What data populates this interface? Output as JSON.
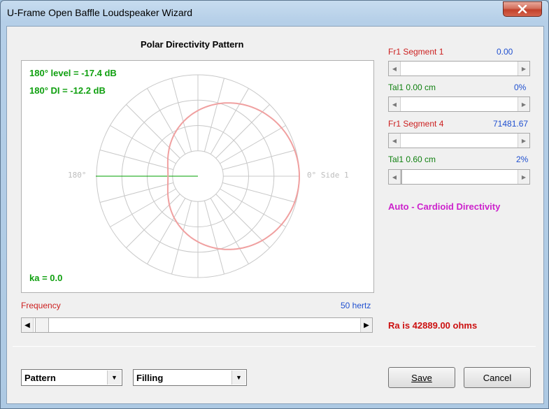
{
  "window": {
    "title": "U-Frame Open Baffle Loudspeaker Wizard"
  },
  "plot": {
    "heading": "Polar Directivity Pattern",
    "level_text": "180° level = -17.4 dB",
    "di_text": "180° DI = -12.2 dB",
    "ka_text": "ka = 0.0",
    "label_180": "180°",
    "label_0": "0° Side 1"
  },
  "chart_data": {
    "type": "polar",
    "title": "Polar Directivity Pattern",
    "pattern": "cardioid",
    "level_180_db": -17.4,
    "di_180_db": -12.2,
    "ka": 0.0
  },
  "frequency": {
    "label": "Frequency",
    "value_text": "50 hertz"
  },
  "params": [
    {
      "label": "Fr1  Segment 1",
      "value": "0.00"
    },
    {
      "label": "Tal1  0.00 cm",
      "value": "0%"
    },
    {
      "label": "Fr1  Segment 4",
      "value": "71481.67"
    },
    {
      "label": "Tal1  0.60 cm",
      "value": "2%"
    }
  ],
  "mode_text": "Auto - Cardioid Directivity",
  "ra_text": "Ra is 42889.00 ohms",
  "selects": {
    "pattern": "Pattern",
    "filling": "Filling"
  },
  "buttons": {
    "save": "Save",
    "cancel": "Cancel"
  },
  "colors": {
    "red": "#cc2020",
    "blue": "#2050d0",
    "green": "#10a010",
    "magenta": "#cc22cc",
    "curve": "#f0a0a0"
  }
}
